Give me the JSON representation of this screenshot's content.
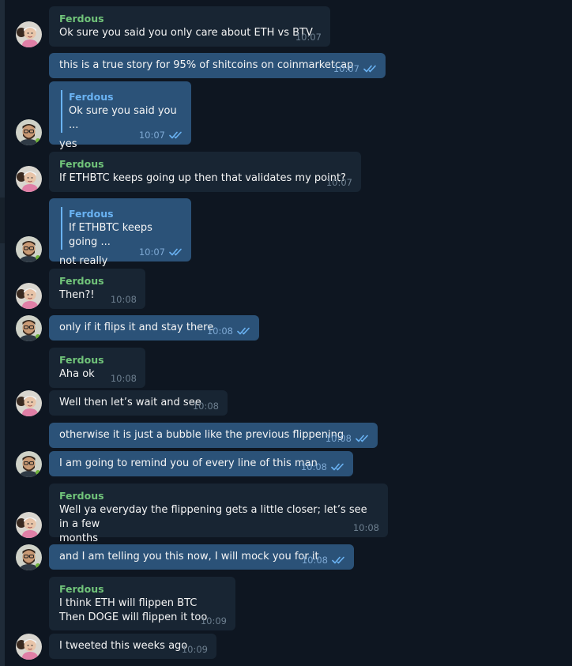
{
  "chat": {
    "contact_name": "Ferdous",
    "colors": {
      "background": "#0e1621",
      "incoming_bubble": "#182533",
      "outgoing_bubble": "#2b5278",
      "sender_name": "#71c47a",
      "reply_accent": "#6ab3f3",
      "read_check": "#6ab3f3"
    },
    "messages": [
      {
        "sender": "Ferdous",
        "text": "Ok sure you said you only care about ETH vs BTV",
        "time": "10:07"
      },
      {
        "text": "this is a true story for 95% of shitcoins on coinmarketcap",
        "time": "10:07",
        "status": "read-double-check-icon"
      },
      {
        "reply_name": "Ferdous",
        "reply_text": "Ok sure you said you ...",
        "text": "yes",
        "time": "10:07",
        "status": "read-double-check-icon"
      },
      {
        "sender": "Ferdous",
        "text": "If ETHBTC keeps going up then that validates my point?",
        "time": "10:07"
      },
      {
        "reply_name": "Ferdous",
        "reply_text": "If ETHBTC keeps going ...",
        "text": "not really",
        "time": "10:07",
        "status": "read-double-check-icon"
      },
      {
        "sender": "Ferdous",
        "text": "Then?!",
        "time": "10:08"
      },
      {
        "text": "only if it flips it and stay there",
        "time": "10:08",
        "status": "read-double-check-icon"
      },
      {
        "sender": "Ferdous",
        "text": "Aha ok",
        "time": "10:08"
      },
      {
        "text": "Well then let’s wait and see",
        "time": "10:08"
      },
      {
        "text": "otherwise it is just a bubble like the previous flippening",
        "time": "10:08",
        "status": "read-double-check-icon"
      },
      {
        "text": "I am going to remind you of every line of this man",
        "time": "10:08",
        "status": "read-double-check-icon"
      },
      {
        "sender": "Ferdous",
        "text": "Well ya everyday the flippening gets a little closer; let’s see in a few\nmonths",
        "time": "10:08"
      },
      {
        "text": "and I am telling you this now, I will mock you for it",
        "time": "10:08",
        "status": "read-double-check-icon"
      },
      {
        "sender": "Ferdous",
        "text": "I think ETH will flippen BTC\nThen DOGE will flippen it too",
        "time": "10:09"
      },
      {
        "text": "I tweeted this weeks ago",
        "time": "10:09"
      }
    ]
  }
}
